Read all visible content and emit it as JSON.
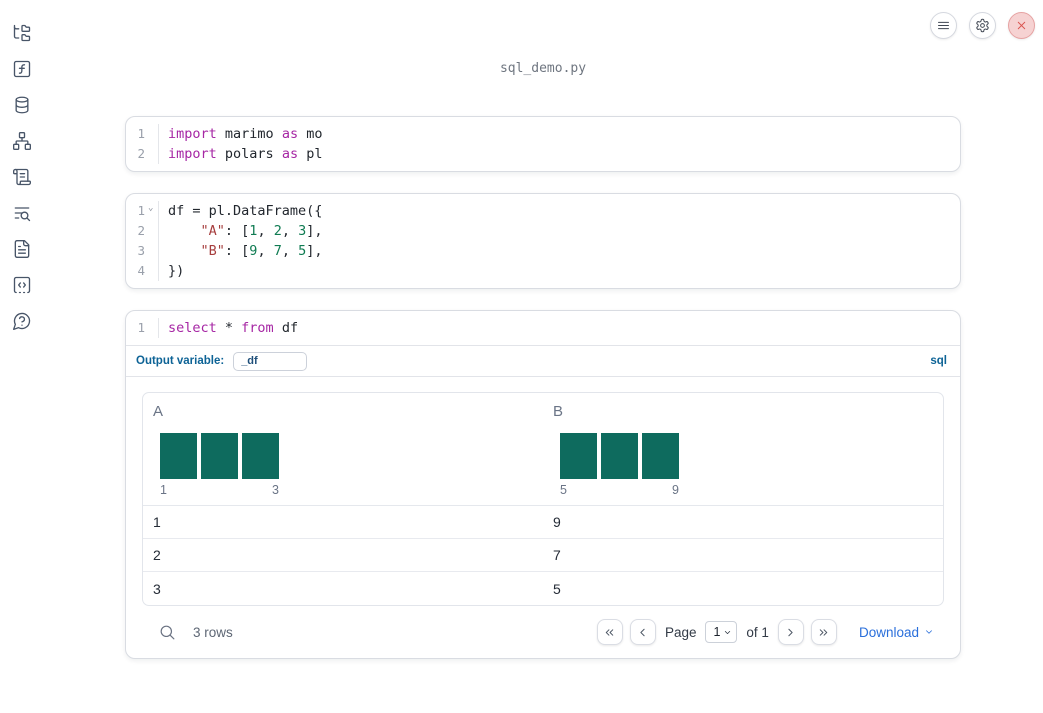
{
  "colors": {
    "keyword": "#a626a4",
    "string": "#a63d3d",
    "number": "#0f7b52",
    "bar": "#0e6b5e",
    "accent_blue": "#0d6396",
    "link_blue": "#2a6fdb",
    "close_red": "#d9534f"
  },
  "header": {
    "filename": "sql_demo.py"
  },
  "sidebar": {
    "items": [
      "file-explorer",
      "variables",
      "datasources",
      "dependency-graph",
      "logs",
      "table-of-contents-search",
      "documentation",
      "snippets",
      "help"
    ]
  },
  "cells": [
    {
      "lines": [
        {
          "num": "1",
          "tokens": [
            [
              "kw",
              "import"
            ],
            [
              "plain",
              " marimo "
            ],
            [
              "kw",
              "as"
            ],
            [
              "plain",
              " mo"
            ]
          ]
        },
        {
          "num": "2",
          "tokens": [
            [
              "kw",
              "import"
            ],
            [
              "plain",
              " polars "
            ],
            [
              "kw",
              "as"
            ],
            [
              "plain",
              " pl"
            ]
          ]
        }
      ]
    },
    {
      "lines": [
        {
          "num": "1",
          "fold": true,
          "tokens": [
            [
              "plain",
              "df = pl.DataFrame({"
            ]
          ]
        },
        {
          "num": "2",
          "tokens": [
            [
              "plain",
              "    "
            ],
            [
              "str",
              "\"A\""
            ],
            [
              "plain",
              ": ["
            ],
            [
              "num",
              "1"
            ],
            [
              "plain",
              ", "
            ],
            [
              "num",
              "2"
            ],
            [
              "plain",
              ", "
            ],
            [
              "num",
              "3"
            ],
            [
              "plain",
              "],"
            ]
          ]
        },
        {
          "num": "3",
          "tokens": [
            [
              "plain",
              "    "
            ],
            [
              "str",
              "\"B\""
            ],
            [
              "plain",
              ": ["
            ],
            [
              "num",
              "9"
            ],
            [
              "plain",
              ", "
            ],
            [
              "num",
              "7"
            ],
            [
              "plain",
              ", "
            ],
            [
              "num",
              "5"
            ],
            [
              "plain",
              "],"
            ]
          ]
        },
        {
          "num": "4",
          "tokens": [
            [
              "plain",
              "})"
            ]
          ]
        }
      ]
    },
    {
      "lines": [
        {
          "num": "1",
          "tokens": [
            [
              "kw",
              "select"
            ],
            [
              "plain",
              " * "
            ],
            [
              "kw",
              "from"
            ],
            [
              "plain",
              " df"
            ]
          ]
        }
      ],
      "output_variable_label": "Output variable:",
      "output_variable_value": "_df",
      "language_badge": "sql"
    }
  ],
  "table": {
    "columns": [
      {
        "name": "A",
        "histogram": {
          "bars": [
            1,
            1,
            1
          ],
          "min_label": "1",
          "max_label": "3"
        }
      },
      {
        "name": "B",
        "histogram": {
          "bars": [
            1,
            1,
            1
          ],
          "min_label": "5",
          "max_label": "9"
        }
      }
    ],
    "rows": [
      [
        "1",
        "9"
      ],
      [
        "2",
        "7"
      ],
      [
        "3",
        "5"
      ]
    ],
    "footer": {
      "row_count": "3 rows",
      "page_label": "Page",
      "page_value": "1",
      "of_label": "of 1",
      "download_label": "Download"
    }
  }
}
